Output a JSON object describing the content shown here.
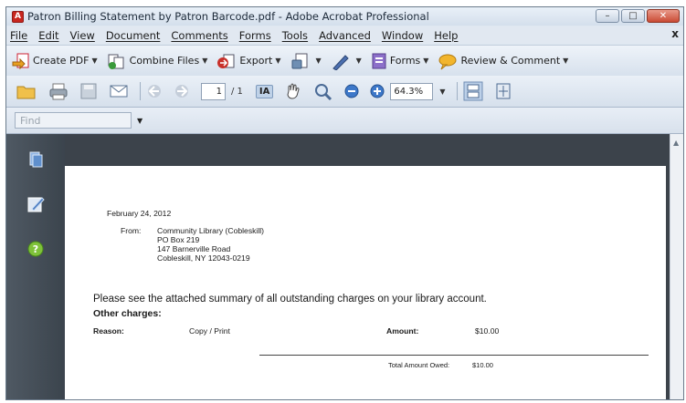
{
  "window": {
    "title": "Patron Billing Statement by Patron Barcode.pdf - Adobe Acrobat Professional",
    "app_icon_glyph": "A"
  },
  "menubar": {
    "items": [
      "File",
      "Edit",
      "View",
      "Document",
      "Comments",
      "Forms",
      "Tools",
      "Advanced",
      "Window",
      "Help"
    ],
    "doc_close": "x"
  },
  "task_toolbar": {
    "create_pdf": "Create PDF",
    "combine_files": "Combine Files",
    "export": "Export",
    "forms": "Forms",
    "review_comment": "Review & Comment"
  },
  "nav_toolbar": {
    "page_number": "1",
    "page_total": "/ 1",
    "select_tool": "IA",
    "zoom": "64.3%"
  },
  "findbar": {
    "placeholder": "Find"
  },
  "document": {
    "date": "February 24, 2012",
    "from_label": "From:",
    "from_lines": [
      "Community Library (Cobleskill)",
      "PO Box 219",
      "147 Barnerville Road",
      "Cobleskill, NY 12043-0219"
    ],
    "intro": "Please see the attached summary of all outstanding charges on your library account.",
    "other_charges": "Other charges:",
    "reason_label": "Reason:",
    "reason_value": "Copy / Print",
    "amount_label": "Amount:",
    "amount_value": "$10.00",
    "total_label": "Total Amount Owed:",
    "total_value": "$10.00"
  },
  "colors": {
    "nav_panel": "#4f5963",
    "doc_background": "#3c434b",
    "toolbar": "#dfe7f1",
    "close_button": "#c94a34"
  }
}
